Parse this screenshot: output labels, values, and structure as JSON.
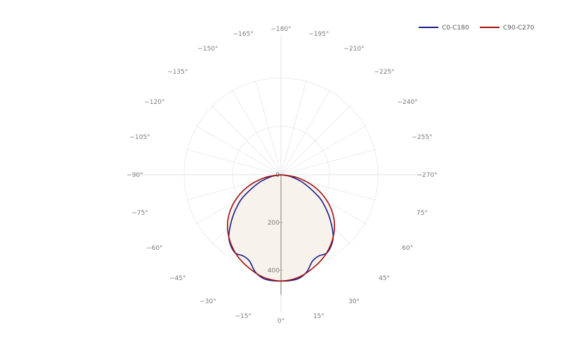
{
  "chart_data": {
    "type": "polar-line",
    "angular_unit": "degrees",
    "radial_ticks": [
      0,
      200,
      400
    ],
    "radial_max": 400,
    "angle_labels": [
      {
        "angle": 0,
        "text": "0°"
      },
      {
        "angle": 15,
        "text": "15°"
      },
      {
        "angle": 30,
        "text": "30°"
      },
      {
        "angle": 45,
        "text": "45°"
      },
      {
        "angle": 60,
        "text": "60°"
      },
      {
        "angle": 75,
        "text": "75°"
      },
      {
        "angle": 90,
        "text": "−270°"
      },
      {
        "angle": 105,
        "text": "−255°"
      },
      {
        "angle": 120,
        "text": "−240°"
      },
      {
        "angle": 135,
        "text": "−225°"
      },
      {
        "angle": 150,
        "text": "−210°"
      },
      {
        "angle": 165,
        "text": "−195°"
      },
      {
        "angle": 180,
        "text": "−180°"
      },
      {
        "angle": 195,
        "text": "−165°"
      },
      {
        "angle": 210,
        "text": "−150°"
      },
      {
        "angle": 225,
        "text": "−135°"
      },
      {
        "angle": 240,
        "text": "−120°"
      },
      {
        "angle": 255,
        "text": "−105°"
      },
      {
        "angle": 270,
        "text": "−90°"
      },
      {
        "angle": 285,
        "text": "−75°"
      },
      {
        "angle": 300,
        "text": "−60°"
      },
      {
        "angle": 315,
        "text": "−45°"
      },
      {
        "angle": 330,
        "text": "−30°"
      },
      {
        "angle": 345,
        "text": "−15°"
      }
    ],
    "series": [
      {
        "name": "C0-C180",
        "color": "#1a1a8c",
        "angles": [
          -90,
          -80,
          -70,
          -60,
          -55,
          -50,
          -45,
          -40,
          -35,
          -30,
          -25,
          -20,
          -15,
          -10,
          -5,
          0,
          5,
          10,
          15,
          20,
          25,
          30,
          35,
          40,
          45,
          50,
          55,
          60,
          70,
          80,
          90
        ],
        "values": [
          0,
          40,
          100,
          180,
          220,
          260,
          300,
          340,
          365,
          380,
          375,
          385,
          420,
          440,
          445,
          445,
          445,
          440,
          420,
          385,
          375,
          380,
          365,
          340,
          300,
          260,
          220,
          180,
          100,
          40,
          0
        ]
      },
      {
        "name": "C90-C270",
        "color": "#a01010",
        "angles": [
          -90,
          -80,
          -70,
          -60,
          -50,
          -40,
          -30,
          -20,
          -10,
          0,
          10,
          20,
          30,
          40,
          50,
          60,
          70,
          80,
          90
        ],
        "values": [
          0,
          70,
          150,
          225,
          290,
          340,
          380,
          410,
          435,
          445,
          435,
          410,
          380,
          340,
          290,
          225,
          150,
          70,
          0
        ]
      }
    ],
    "fill_color": "#f7f3ec",
    "grid": true,
    "legend_position": "top-right"
  }
}
